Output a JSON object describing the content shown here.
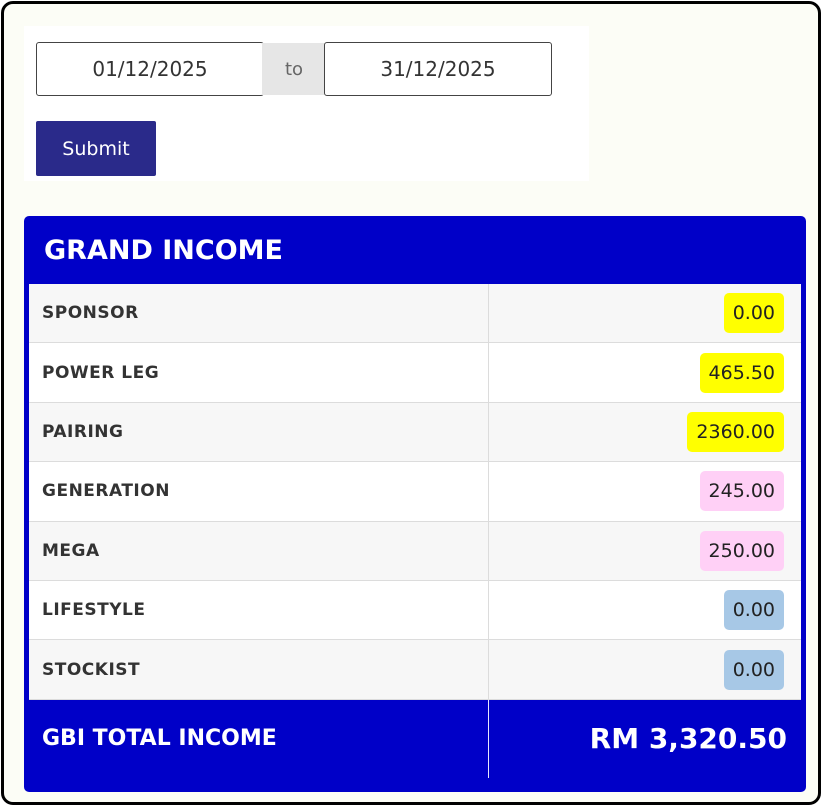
{
  "filter": {
    "date_from": "01/12/2025",
    "to_label": "to",
    "date_to": "31/12/2025",
    "submit_label": "Submit"
  },
  "income": {
    "title": "GRAND INCOME",
    "rows": [
      {
        "label": "SPONSOR",
        "value": "0.00",
        "badge_color": "#ffff00"
      },
      {
        "label": "POWER LEG",
        "value": "465.50",
        "badge_color": "#ffff00"
      },
      {
        "label": "PAIRING",
        "value": "2360.00",
        "badge_color": "#ffff00"
      },
      {
        "label": "GENERATION",
        "value": "245.00",
        "badge_color": "#ffd0f6"
      },
      {
        "label": "MEGA",
        "value": "250.00",
        "badge_color": "#ffd0f6"
      },
      {
        "label": "LIFESTYLE",
        "value": "0.00",
        "badge_color": "#a7c8e6"
      },
      {
        "label": "STOCKIST",
        "value": "0.00",
        "badge_color": "#a7c8e6"
      }
    ],
    "total_label": "GBI TOTAL INCOME",
    "total_value": "RM 3,320.50"
  },
  "colors": {
    "panel_blue": "#0000c8",
    "submit_bg": "#2a2a8a"
  }
}
